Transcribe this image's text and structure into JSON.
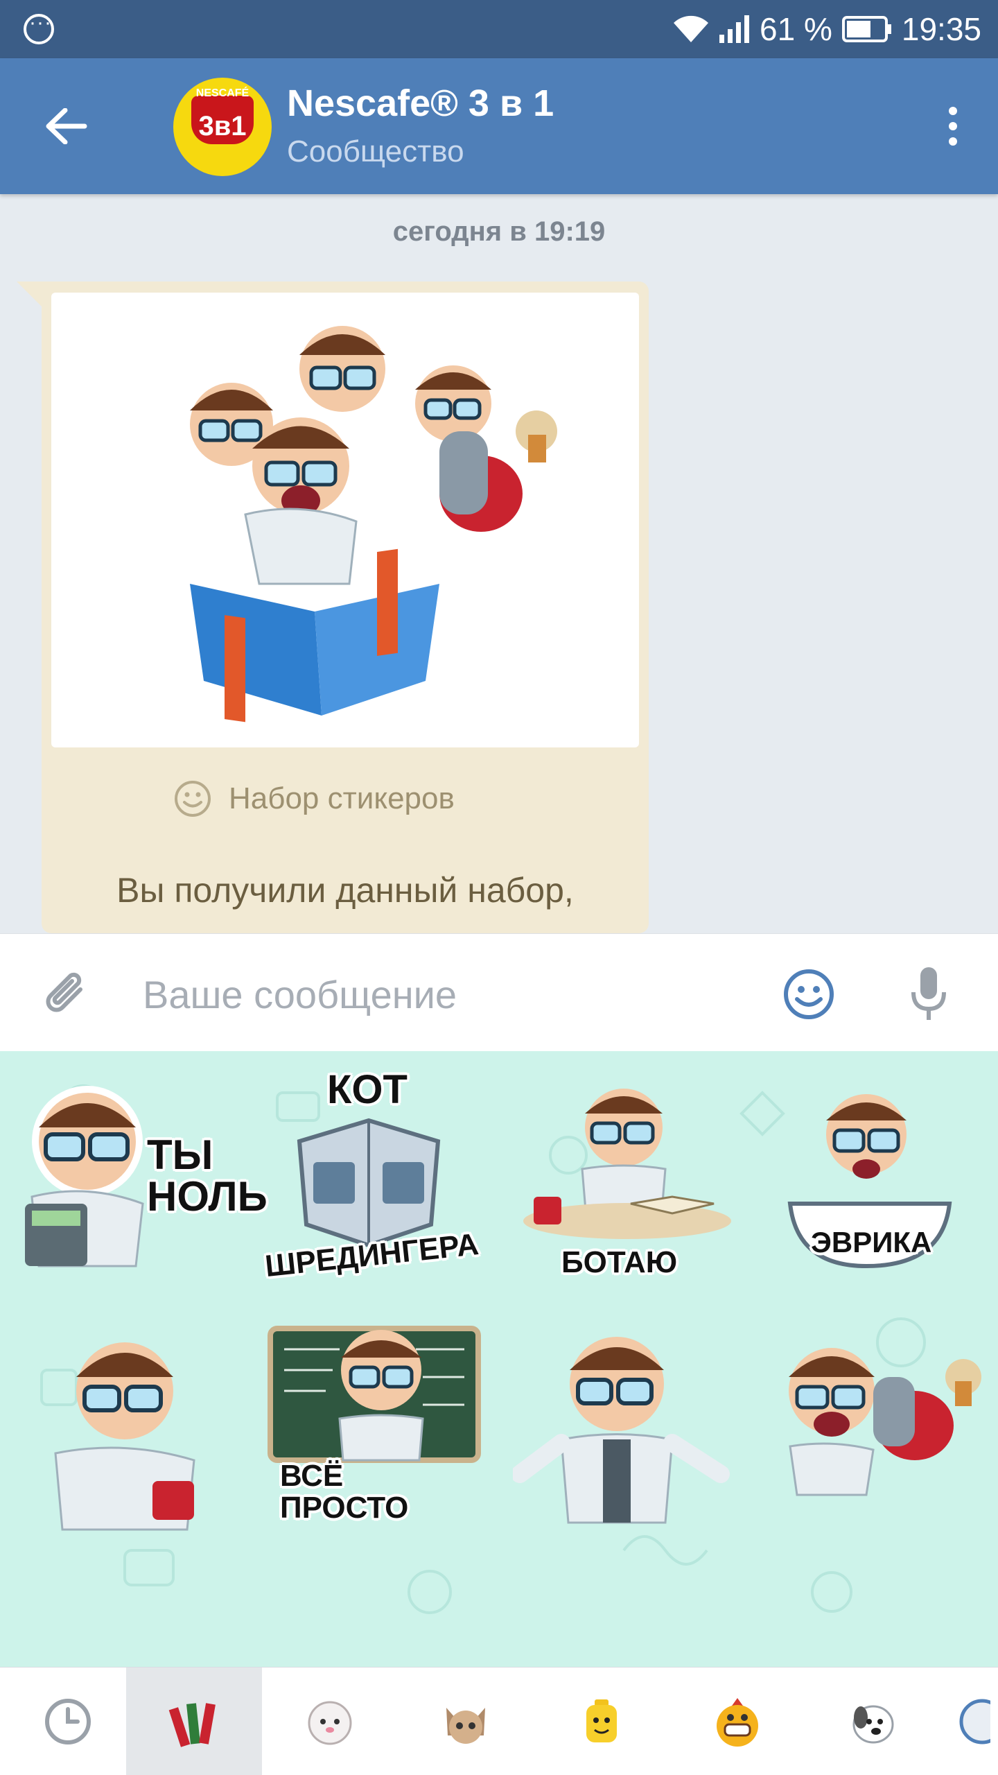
{
  "status_bar": {
    "battery_percent": "61 %",
    "time": "19:35"
  },
  "header": {
    "title": "Nescafe® 3 в 1",
    "subtitle": "Сообщество",
    "avatar_brand": "NESCAFÉ",
    "avatar_mark": "3в1"
  },
  "chat": {
    "date_divider": "сегодня в 19:19",
    "message": {
      "sticker_set_label": "Набор стикеров",
      "text": "Вы получили данный набор,"
    }
  },
  "composer": {
    "placeholder": "Ваше сообщение"
  },
  "sticker_panel": {
    "stickers": [
      {
        "caption": "ТЫ\nНОЛЬ"
      },
      {
        "caption_top": "КОТ",
        "caption_bottom": "ШРЕДИНГЕРА"
      },
      {
        "caption": "БОТАЮ"
      },
      {
        "caption": "ЭВРИКА"
      },
      {
        "caption": ""
      },
      {
        "caption": "ВСЁ\nПРОСТО"
      },
      {
        "caption": ""
      },
      {
        "caption": ""
      }
    ]
  },
  "tabs": [
    {
      "icon": "clock-icon",
      "active": false
    },
    {
      "icon": "nescafe-sticks-icon",
      "active": true
    },
    {
      "icon": "cat-sticker-icon",
      "active": false
    },
    {
      "icon": "cat-face-sticker-icon",
      "active": false
    },
    {
      "icon": "lego-head-icon",
      "active": false
    },
    {
      "icon": "monster-sticker-icon",
      "active": false
    },
    {
      "icon": "dog-sticker-icon",
      "active": false
    }
  ],
  "colors": {
    "header": "#4f7fb8",
    "status_bar": "#3b5d87",
    "bubble": "#f2ead4",
    "sticker_bg": "#cdf3ea",
    "accent": "#4f7fb8"
  }
}
